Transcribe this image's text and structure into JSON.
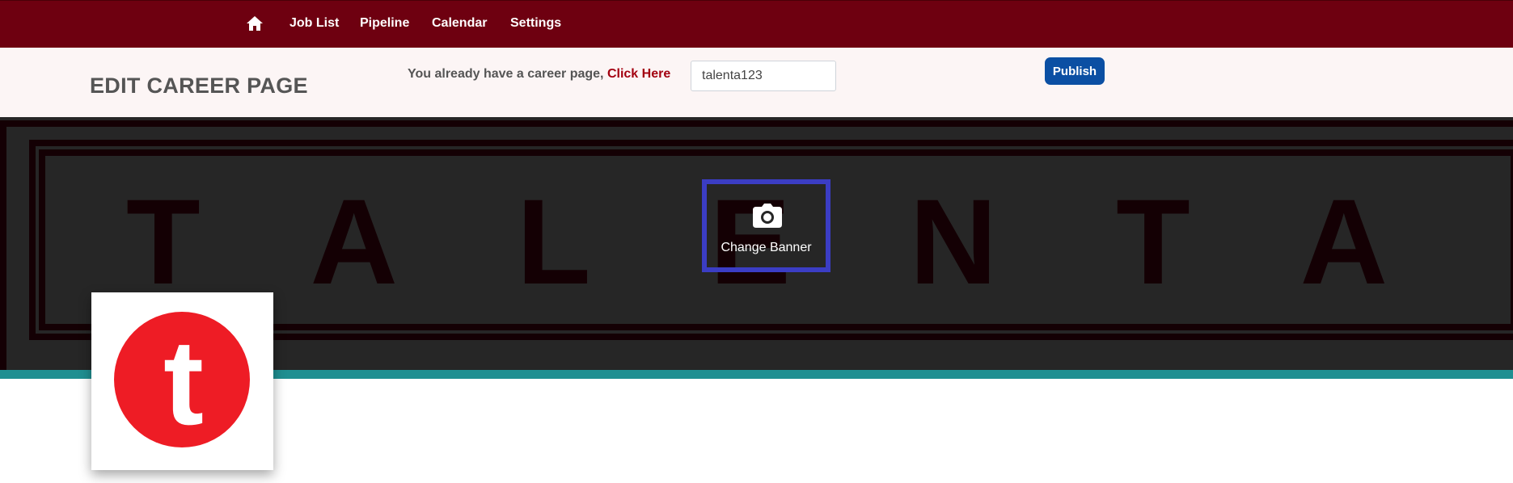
{
  "nav": {
    "home_icon": "home-icon",
    "items": [
      {
        "label": "Job List"
      },
      {
        "label": "Pipeline"
      },
      {
        "label": "Calendar"
      },
      {
        "label": "Settings"
      }
    ]
  },
  "header": {
    "title": "EDIT CAREER PAGE",
    "notice_text": "You already have a career page, ",
    "notice_link": "Click Here",
    "slug_value": "talenta123",
    "publish_label": "Publish"
  },
  "banner": {
    "image_text": "TALENTA",
    "change_label": "Change Banner",
    "change_icon": "camera-icon"
  },
  "logo": {
    "letter": "t",
    "icon": "company-logo"
  },
  "colors": {
    "nav_bg": "#6e0010",
    "subheader_bg": "#fcf5f5",
    "link": "#a30010",
    "publish": "#0b4fa3",
    "banner_bg": "#262626",
    "teal": "#1f8f91",
    "change_border": "#3b3dc4",
    "logo_red": "#ee1c25"
  }
}
